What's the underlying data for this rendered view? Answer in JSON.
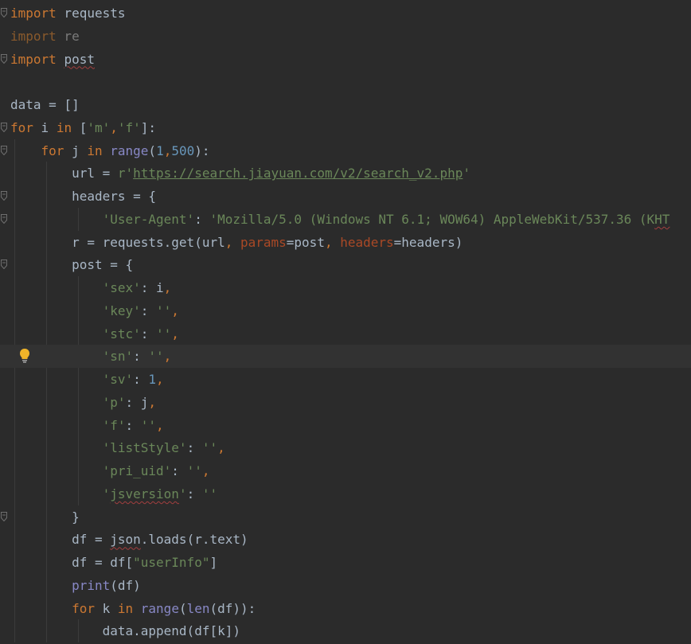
{
  "editor": {
    "lines": [
      [
        [
          "kw",
          "import"
        ],
        [
          "d",
          " requests"
        ]
      ],
      [
        [
          "kw-dim",
          "import"
        ],
        [
          "dim",
          " re"
        ]
      ],
      [
        [
          "kw",
          "import"
        ],
        [
          "d",
          " "
        ],
        [
          "typo",
          "post"
        ]
      ],
      [],
      [
        [
          "d",
          "data = []"
        ]
      ],
      [
        [
          "kw",
          "for"
        ],
        [
          "d",
          " i "
        ],
        [
          "kw",
          "in"
        ],
        [
          "d",
          " ["
        ],
        [
          "str",
          "'m'"
        ],
        [
          "kw",
          ","
        ],
        [
          "str",
          "'f'"
        ],
        [
          "d",
          "]:"
        ]
      ],
      [
        [
          "d",
          "    "
        ],
        [
          "kw",
          "for"
        ],
        [
          "d",
          " j "
        ],
        [
          "kw",
          "in"
        ],
        [
          "d",
          " "
        ],
        [
          "bi",
          "range"
        ],
        [
          "d",
          "("
        ],
        [
          "num",
          "1"
        ],
        [
          "kw",
          ","
        ],
        [
          "num",
          "500"
        ],
        [
          "d",
          "):"
        ]
      ],
      [
        [
          "d",
          "        url = "
        ],
        [
          "str",
          "r'"
        ],
        [
          "link",
          "https://search.jiayuan.com/v2/search_v2.php"
        ],
        [
          "str",
          "'"
        ]
      ],
      [
        [
          "d",
          "        headers = {"
        ]
      ],
      [
        [
          "d",
          "            "
        ],
        [
          "str",
          "'User-Agent'"
        ],
        [
          "d",
          ": "
        ],
        [
          "str",
          "'Mozilla/5.0 (Windows NT 6.1; WOW64) AppleWebKit/537.36 (K"
        ],
        [
          "typo-str",
          "HT"
        ]
      ],
      [
        [
          "d",
          "        r = requests.get(url"
        ],
        [
          "kw",
          ", "
        ],
        [
          "param",
          "params"
        ],
        [
          "d",
          "=post"
        ],
        [
          "kw",
          ", "
        ],
        [
          "param",
          "headers"
        ],
        [
          "d",
          "=headers)"
        ]
      ],
      [
        [
          "d",
          "        post = {"
        ]
      ],
      [
        [
          "d",
          "            "
        ],
        [
          "str",
          "'sex'"
        ],
        [
          "d",
          ": i"
        ],
        [
          "kw",
          ","
        ]
      ],
      [
        [
          "d",
          "            "
        ],
        [
          "str",
          "'key'"
        ],
        [
          "d",
          ": "
        ],
        [
          "str",
          "''"
        ],
        [
          "kw",
          ","
        ]
      ],
      [
        [
          "d",
          "            "
        ],
        [
          "str",
          "'stc'"
        ],
        [
          "d",
          ": "
        ],
        [
          "str",
          "''"
        ],
        [
          "kw",
          ","
        ]
      ],
      [
        [
          "d",
          "            "
        ],
        [
          "str",
          "'sn'"
        ],
        [
          "d",
          ": "
        ],
        [
          "str",
          "''"
        ],
        [
          "kw",
          ","
        ]
      ],
      [
        [
          "d",
          "            "
        ],
        [
          "str",
          "'sv'"
        ],
        [
          "d",
          ": "
        ],
        [
          "num",
          "1"
        ],
        [
          "kw",
          ","
        ]
      ],
      [
        [
          "d",
          "            "
        ],
        [
          "str",
          "'p'"
        ],
        [
          "d",
          ": j"
        ],
        [
          "kw",
          ","
        ]
      ],
      [
        [
          "d",
          "            "
        ],
        [
          "str",
          "'f'"
        ],
        [
          "d",
          ": "
        ],
        [
          "str",
          "''"
        ],
        [
          "kw",
          ","
        ]
      ],
      [
        [
          "d",
          "            "
        ],
        [
          "str",
          "'listStyle'"
        ],
        [
          "d",
          ": "
        ],
        [
          "str",
          "''"
        ],
        [
          "kw",
          ","
        ]
      ],
      [
        [
          "d",
          "            "
        ],
        [
          "str",
          "'pri_uid'"
        ],
        [
          "d",
          ": "
        ],
        [
          "str",
          "''"
        ],
        [
          "kw",
          ","
        ]
      ],
      [
        [
          "d",
          "            "
        ],
        [
          "str",
          "'"
        ],
        [
          "typo-str",
          "jsversion"
        ],
        [
          "str",
          "'"
        ],
        [
          "d",
          ": "
        ],
        [
          "str",
          "''"
        ]
      ],
      [
        [
          "d",
          "        }"
        ]
      ],
      [
        [
          "d",
          "        df = "
        ],
        [
          "typo",
          "json"
        ],
        [
          "d",
          ".loads(r.text)"
        ]
      ],
      [
        [
          "d",
          "        df = df["
        ],
        [
          "str",
          "\"userInfo\""
        ],
        [
          "d",
          "]"
        ]
      ],
      [
        [
          "d",
          "        "
        ],
        [
          "bi",
          "print"
        ],
        [
          "d",
          "(df)"
        ]
      ],
      [
        [
          "d",
          "        "
        ],
        [
          "kw",
          "for"
        ],
        [
          "d",
          " k "
        ],
        [
          "kw",
          "in"
        ],
        [
          "d",
          " "
        ],
        [
          "bi",
          "range"
        ],
        [
          "d",
          "("
        ],
        [
          "bi",
          "len"
        ],
        [
          "d",
          "(df)):"
        ]
      ],
      [
        [
          "d",
          "            data.append(df[k])"
        ]
      ]
    ],
    "current_line": 15,
    "fold_markers": [
      0,
      2,
      5,
      6,
      8,
      9,
      11,
      22
    ],
    "bulb_line": 15,
    "icons": {
      "fold": "fold-marker-icon",
      "bulb": "lightbulb-icon"
    },
    "colors": {
      "background": "#2b2b2b",
      "current_line": "#323232",
      "keyword": "#cc7832",
      "string": "#6a8759",
      "number": "#6897bb",
      "builtin": "#8888c6",
      "parameter": "#aa4926",
      "text": "#a9b7c6",
      "bulb": "#f0b429"
    }
  }
}
